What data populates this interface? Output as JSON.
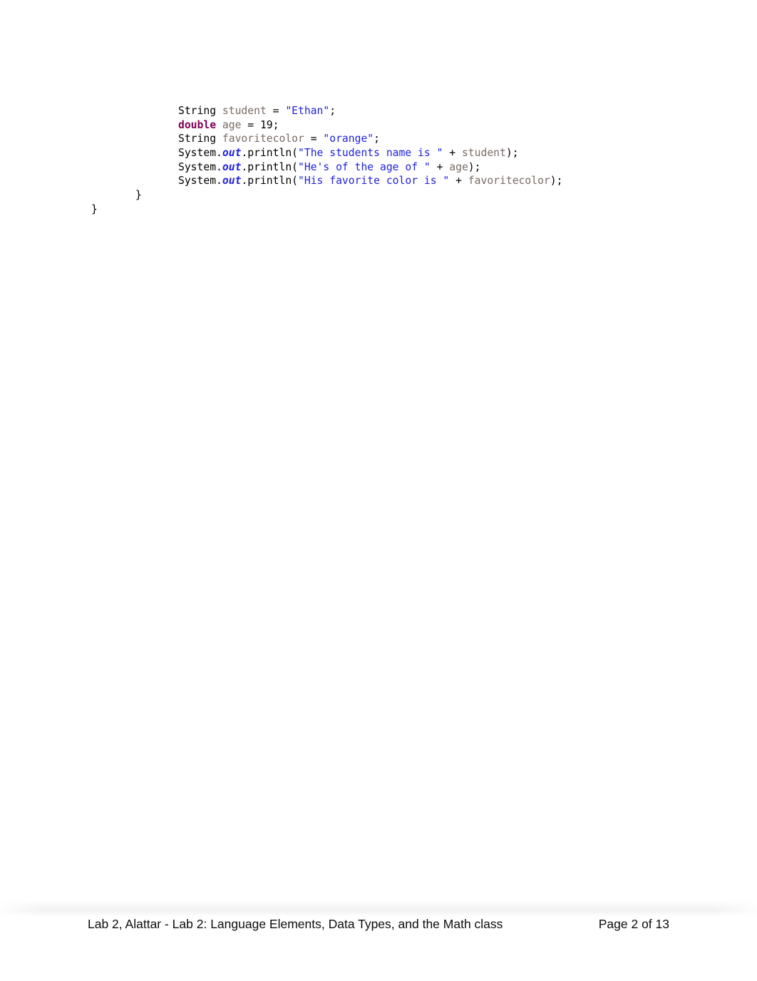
{
  "document": {
    "page_background": "#ffffff",
    "code": {
      "font": "monospace",
      "syntax_colors": {
        "plain": "#000000",
        "keyword": "#7f0055",
        "string_literal": "#2222dd",
        "variable": "#7a6a64",
        "static_field": "#2222dd"
      },
      "lines": [
        {
          "indent": "deep",
          "tokens": [
            {
              "text": "String ",
              "type": "plain"
            },
            {
              "text": "student",
              "type": "var"
            },
            {
              "text": " = ",
              "type": "plain"
            },
            {
              "text": "\"Ethan\"",
              "type": "str"
            },
            {
              "text": ";",
              "type": "plain"
            }
          ]
        },
        {
          "indent": "deep",
          "tokens": [
            {
              "text": "double",
              "type": "kw"
            },
            {
              "text": " ",
              "type": "plain"
            },
            {
              "text": "age",
              "type": "var"
            },
            {
              "text": " = ",
              "type": "plain"
            },
            {
              "text": "19",
              "type": "num"
            },
            {
              "text": ";",
              "type": "plain"
            }
          ]
        },
        {
          "indent": "deep",
          "tokens": [
            {
              "text": "String ",
              "type": "plain"
            },
            {
              "text": "favoritecolor",
              "type": "var"
            },
            {
              "text": " = ",
              "type": "plain"
            },
            {
              "text": "\"orange\"",
              "type": "str"
            },
            {
              "text": ";",
              "type": "plain"
            }
          ]
        },
        {
          "indent": "deep",
          "tokens": [
            {
              "text": "System.",
              "type": "plain"
            },
            {
              "text": "out",
              "type": "field"
            },
            {
              "text": ".println(",
              "type": "plain"
            },
            {
              "text": "\"The students name is \"",
              "type": "str"
            },
            {
              "text": " + ",
              "type": "plain"
            },
            {
              "text": "student",
              "type": "var"
            },
            {
              "text": ");",
              "type": "plain"
            }
          ]
        },
        {
          "indent": "deep",
          "tokens": [
            {
              "text": "System.",
              "type": "plain"
            },
            {
              "text": "out",
              "type": "field"
            },
            {
              "text": ".println(",
              "type": "plain"
            },
            {
              "text": "\"He's of the age of \"",
              "type": "str"
            },
            {
              "text": " + ",
              "type": "plain"
            },
            {
              "text": "age",
              "type": "var"
            },
            {
              "text": ");",
              "type": "plain"
            }
          ]
        },
        {
          "indent": "deep",
          "tokens": [
            {
              "text": "System.",
              "type": "plain"
            },
            {
              "text": "out",
              "type": "field"
            },
            {
              "text": ".println(",
              "type": "plain"
            },
            {
              "text": "\"His favorite color is \"",
              "type": "str"
            },
            {
              "text": " + ",
              "type": "plain"
            },
            {
              "text": "favoritecolor",
              "type": "var"
            },
            {
              "text": ");",
              "type": "plain"
            }
          ]
        },
        {
          "indent": "mid",
          "tokens": [
            {
              "text": "}",
              "type": "plain"
            }
          ]
        },
        {
          "indent": "outer",
          "tokens": [
            {
              "text": "}",
              "type": "plain"
            }
          ]
        }
      ]
    },
    "footer": {
      "left_text": "Lab 2, Alattar - Lab 2: Language Elements, Data Types, and the Math class",
      "right_text": "Page 2 of 13"
    }
  }
}
